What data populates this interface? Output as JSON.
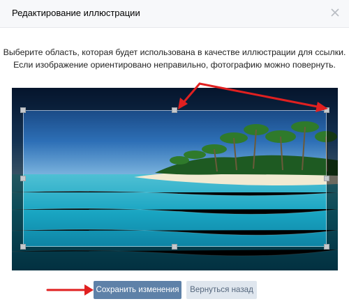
{
  "dialog": {
    "title": "Редактирование иллюстрации",
    "close_icon": "close-icon"
  },
  "instructions": {
    "line1": "Выберите область, которая будет использована в качестве иллюстрации для ссылки.",
    "line2": "Если изображение ориентировано неправильно, фотографию можно повернуть."
  },
  "image": {
    "description": "tropical-beach-photo",
    "crop_handles": 8
  },
  "buttons": {
    "save_label": "Сохранить изменения",
    "back_label": "Вернуться назад"
  },
  "colors": {
    "header_bg": "#f7f8fa",
    "primary_button": "#5e81a8",
    "secondary_button": "#dfe6ee",
    "annotation_arrow": "#e02020"
  }
}
